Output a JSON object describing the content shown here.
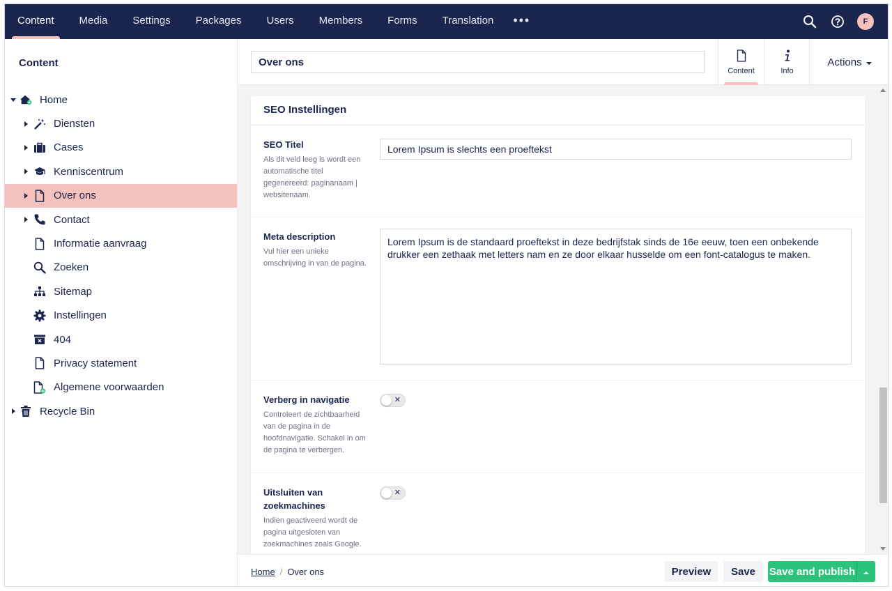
{
  "topnav": {
    "sections": [
      "Content",
      "Media",
      "Settings",
      "Packages",
      "Users",
      "Members",
      "Forms",
      "Translation"
    ],
    "active": "Content",
    "more": "•••",
    "user_initial": "F",
    "icons": [
      "search-icon",
      "help-icon"
    ]
  },
  "sidebar": {
    "title": "Content",
    "tree": [
      {
        "label": "Home",
        "icon": "home-icon",
        "level": 0,
        "caret": "down"
      },
      {
        "label": "Diensten",
        "icon": "magic-wand-icon",
        "level": 1,
        "caret": "right"
      },
      {
        "label": "Cases",
        "icon": "briefcase-icon",
        "level": 1,
        "caret": "right"
      },
      {
        "label": "Kenniscentrum",
        "icon": "graduation-cap-icon",
        "level": 1,
        "caret": "right"
      },
      {
        "label": "Over ons",
        "icon": "document-icon",
        "level": 1,
        "caret": "right",
        "selected": true
      },
      {
        "label": "Contact",
        "icon": "phone-icon",
        "level": 1,
        "caret": "right"
      },
      {
        "label": "Informatie aanvraag",
        "icon": "document-icon",
        "level": 1,
        "caret": "none"
      },
      {
        "label": "Zoeken",
        "icon": "search-icon",
        "level": 1,
        "caret": "none"
      },
      {
        "label": "Sitemap",
        "icon": "sitemap-icon",
        "level": 1,
        "caret": "none"
      },
      {
        "label": "Instellingen",
        "icon": "gear-icon",
        "level": 1,
        "caret": "none"
      },
      {
        "label": "404",
        "icon": "missing-box-icon",
        "level": 1,
        "caret": "none"
      },
      {
        "label": "Privacy statement",
        "icon": "document-icon",
        "level": 1,
        "caret": "none"
      },
      {
        "label": "Algemene voorwaarden",
        "icon": "document-plus-icon",
        "level": 1,
        "caret": "none"
      },
      {
        "label": "Recycle Bin",
        "icon": "trash-icon",
        "level": 0,
        "caret": "right"
      }
    ]
  },
  "editor": {
    "name_value": "Over ons",
    "apps": [
      {
        "label": "Content",
        "icon": "document-icon",
        "active": true
      },
      {
        "label": "Info",
        "icon": "info-icon",
        "active": false
      }
    ],
    "actions_label": "Actions"
  },
  "panel": {
    "title": "SEO Instellingen",
    "seo_title": {
      "label": "SEO Titel",
      "description": "Als dit veld leeg is wordt een automatische titel gegenereerd: paginanaam | websitenaam.",
      "value": "Lorem Ipsum is slechts een proeftekst"
    },
    "meta_description": {
      "label": "Meta description",
      "description": "Vul hier een unieke omschrijving in van de pagina.",
      "value": "Lorem Ipsum is de standaard proeftekst in deze bedrijfstak sinds de 16e eeuw, toen een onbekende drukker een zethaak met letters nam en ze door elkaar husselde om een font-catalogus te maken."
    },
    "hide_nav": {
      "label": "Verberg in navigatie",
      "description": "Controleert de zichtbaarheid van de pagina in de hoofdnavigatie. Schakel in om de pagina te verbergen.",
      "toggle_symbol": "✕"
    },
    "exclude_search": {
      "label": "Uitsluiten van zoekmachines",
      "description": "Indien geactiveerd wordt de pagina uitgesloten van zoekmachines zoals Google.",
      "toggle_symbol": "✕"
    }
  },
  "footer": {
    "breadcrumb": [
      "Home",
      "Over ons"
    ],
    "preview_label": "Preview",
    "save_label": "Save",
    "publish_label": "Save and publish"
  },
  "colors": {
    "topbar": "#1b264f",
    "selected": "#f5c1bc",
    "publish": "#2bc37c"
  }
}
